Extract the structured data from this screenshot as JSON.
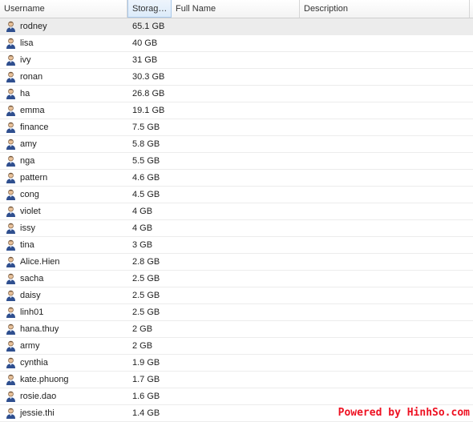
{
  "columns": {
    "username": "Username",
    "storage": "Storag…",
    "fullname": "Full Name",
    "description": "Description"
  },
  "users": [
    {
      "username": "rodney",
      "storage": "65.1 GB",
      "fullname": "",
      "description": ""
    },
    {
      "username": "lisa",
      "storage": "40 GB",
      "fullname": "",
      "description": ""
    },
    {
      "username": "ivy",
      "storage": "31 GB",
      "fullname": "",
      "description": ""
    },
    {
      "username": "ronan",
      "storage": "30.3 GB",
      "fullname": "",
      "description": ""
    },
    {
      "username": "ha",
      "storage": "26.8 GB",
      "fullname": "",
      "description": ""
    },
    {
      "username": "emma",
      "storage": "19.1 GB",
      "fullname": "",
      "description": ""
    },
    {
      "username": "finance",
      "storage": "7.5 GB",
      "fullname": "",
      "description": ""
    },
    {
      "username": "amy",
      "storage": "5.8 GB",
      "fullname": "",
      "description": ""
    },
    {
      "username": "nga",
      "storage": "5.5 GB",
      "fullname": "",
      "description": ""
    },
    {
      "username": "pattern",
      "storage": "4.6 GB",
      "fullname": "",
      "description": ""
    },
    {
      "username": "cong",
      "storage": "4.5 GB",
      "fullname": "",
      "description": ""
    },
    {
      "username": "violet",
      "storage": "4 GB",
      "fullname": "",
      "description": ""
    },
    {
      "username": "issy",
      "storage": "4 GB",
      "fullname": "",
      "description": ""
    },
    {
      "username": "tina",
      "storage": "3 GB",
      "fullname": "",
      "description": ""
    },
    {
      "username": "Alice.Hien",
      "storage": "2.8 GB",
      "fullname": "",
      "description": ""
    },
    {
      "username": "sacha",
      "storage": "2.5 GB",
      "fullname": "",
      "description": ""
    },
    {
      "username": "daisy",
      "storage": "2.5 GB",
      "fullname": "",
      "description": ""
    },
    {
      "username": "linh01",
      "storage": "2.5 GB",
      "fullname": "",
      "description": ""
    },
    {
      "username": "hana.thuy",
      "storage": "2 GB",
      "fullname": "",
      "description": ""
    },
    {
      "username": "army",
      "storage": "2 GB",
      "fullname": "",
      "description": ""
    },
    {
      "username": "cynthia",
      "storage": "1.9 GB",
      "fullname": "",
      "description": ""
    },
    {
      "username": "kate.phuong",
      "storage": "1.7 GB",
      "fullname": "",
      "description": ""
    },
    {
      "username": "rosie.dao",
      "storage": "1.6 GB",
      "fullname": "",
      "description": ""
    },
    {
      "username": "jessie.thi",
      "storage": "1.4 GB",
      "fullname": "",
      "description": ""
    }
  ],
  "icon": "user-icon",
  "colors": {
    "selected_row": "#ececec",
    "sorted_header": "#dcebfa",
    "watermark": "#ee1122"
  },
  "watermark": "Powered by HinhSo.com"
}
